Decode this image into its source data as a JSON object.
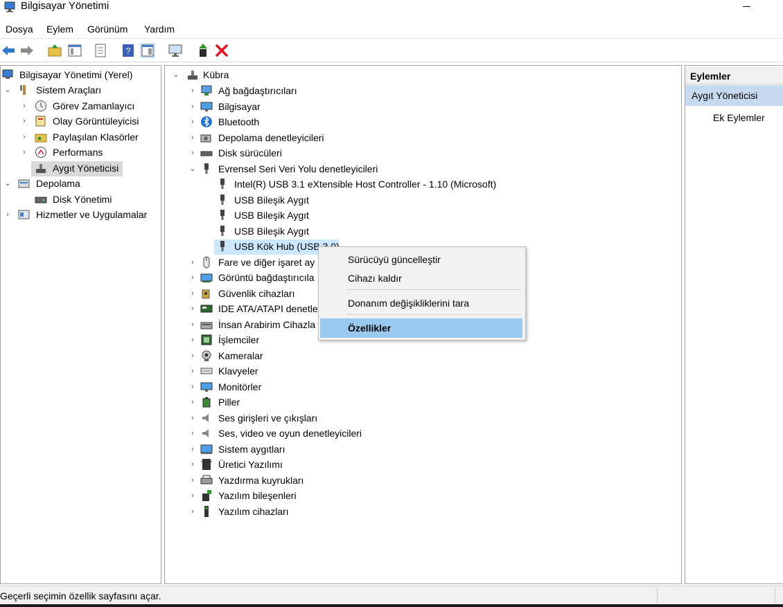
{
  "window": {
    "title": "Bilgisayar Yönetimi",
    "icon": "computer-management-icon"
  },
  "menu": [
    "Dosya",
    "Eylem",
    "Görünüm",
    "Yardım"
  ],
  "toolbar": [
    "back-arrow-icon",
    "forward-arrow-icon",
    "up-folder-icon",
    "show-hide-tree-icon",
    "properties-icon",
    "help-icon",
    "view-icon",
    "monitor-icon",
    "update-driver-icon",
    "delete-icon"
  ],
  "left_tree": [
    {
      "label": "Bilgisayar Yönetimi (Yerel)",
      "icon": "computer-management-icon"
    },
    {
      "label": "Sistem Araçları",
      "icon": "tools-icon"
    },
    {
      "label": "Görev Zamanlayıcı",
      "icon": "clock-icon"
    },
    {
      "label": "Olay Görüntüleyicisi",
      "icon": "event-viewer-icon"
    },
    {
      "label": "Paylaşılan Klasörler",
      "icon": "shared-folder-icon"
    },
    {
      "label": "Performans",
      "icon": "performance-icon"
    },
    {
      "label": "Aygıt Yöneticisi",
      "icon": "device-manager-icon"
    },
    {
      "label": "Depolama",
      "icon": "storage-icon"
    },
    {
      "label": "Disk Yönetimi",
      "icon": "disk-icon"
    },
    {
      "label": "Hizmetler ve Uygulamalar",
      "icon": "services-icon"
    }
  ],
  "device_tree": {
    "root": "Kübra",
    "categories": [
      {
        "label": "Ağ bağdaştırıcıları",
        "icon": "network-adapter-icon"
      },
      {
        "label": "Bilgisayar",
        "icon": "computer-icon"
      },
      {
        "label": "Bluetooth",
        "icon": "bluetooth-icon"
      },
      {
        "label": "Depolama denetleyicileri",
        "icon": "storage-controller-icon"
      },
      {
        "label": "Disk sürücüleri",
        "icon": "disk-drive-icon"
      },
      {
        "label": "Evrensel Seri Veri Yolu denetleyicileri",
        "icon": "usb-icon"
      },
      {
        "label": "Intel(R) USB 3.1 eXtensible Host Controller - 1.10 (Microsoft)",
        "icon": "usb-icon"
      },
      {
        "label": "USB Bileşik Aygıt",
        "icon": "usb-icon"
      },
      {
        "label": "USB Bileşik Aygıt",
        "icon": "usb-icon"
      },
      {
        "label": "USB Bileşik Aygıt",
        "icon": "usb-icon"
      },
      {
        "label": "USB Kök Hub (USB 3.0)",
        "icon": "usb-icon"
      },
      {
        "label": "Fare ve diğer işaret ay",
        "icon": "mouse-icon"
      },
      {
        "label": "Görüntü bağdaştırıcıla",
        "icon": "display-adapter-icon"
      },
      {
        "label": "Güvenlik cihazları",
        "icon": "security-device-icon"
      },
      {
        "label": "IDE ATA/ATAPI denetley",
        "icon": "ide-controller-icon"
      },
      {
        "label": "İnsan Arabirim Cihazla",
        "icon": "hid-icon"
      },
      {
        "label": "İşlemciler",
        "icon": "processor-icon"
      },
      {
        "label": "Kameralar",
        "icon": "camera-icon"
      },
      {
        "label": "Klavyeler",
        "icon": "keyboard-icon"
      },
      {
        "label": "Monitörler",
        "icon": "monitor-icon"
      },
      {
        "label": "Piller",
        "icon": "battery-icon"
      },
      {
        "label": "Ses girişleri ve çıkışları",
        "icon": "speaker-icon"
      },
      {
        "label": "Ses, video ve oyun denetleyicileri",
        "icon": "speaker-icon"
      },
      {
        "label": "Sistem aygıtları",
        "icon": "system-device-icon"
      },
      {
        "label": "Üretici Yazılımı",
        "icon": "firmware-icon"
      },
      {
        "label": "Yazdırma kuyrukları",
        "icon": "printer-icon"
      },
      {
        "label": "Yazılım bileşenleri",
        "icon": "software-component-icon"
      },
      {
        "label": "Yazılım cihazları",
        "icon": "software-device-icon"
      }
    ]
  },
  "actions": {
    "header": "Eylemler",
    "section": "Aygıt Yöneticisi",
    "more": "Ek Eylemler"
  },
  "context_menu": [
    "Sürücüyü güncelleştir",
    "Cihazı kaldır",
    "Donanım değişikliklerini tara",
    "Özellikler"
  ],
  "status": {
    "text": "Geçerli seçimin özellik sayfasını açar."
  },
  "colors": {
    "selection_blue": "#cce8ff",
    "menu_highlight": "#99c9ef",
    "actions_band": "#c7d9ee",
    "delete_red": "#e81123"
  }
}
